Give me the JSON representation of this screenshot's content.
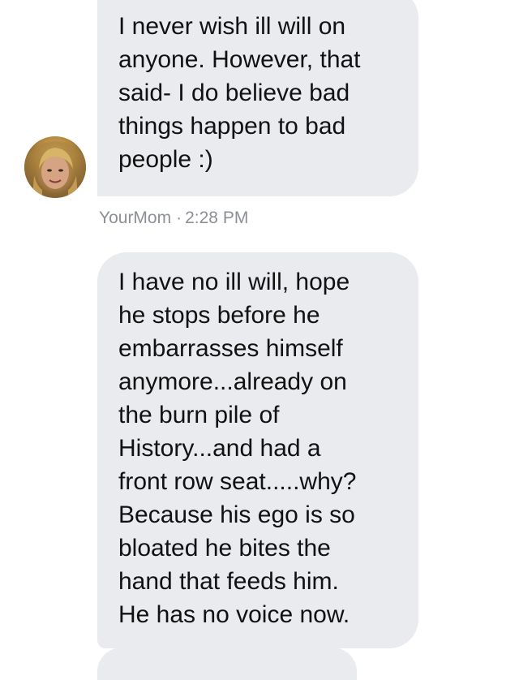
{
  "messages": [
    {
      "lines": [
        "I never wish ill will on",
        "anyone. However, that",
        "said- I do believe bad",
        "things happen to bad",
        "people :)"
      ]
    },
    {
      "lines": [
        "I have no ill will, hope",
        "he stops before he",
        "embarrasses himself",
        "anymore...already on",
        "the burn pile of",
        "History...and had a",
        "front row seat.....why?",
        "Because his ego is so",
        "bloated he bites the",
        "hand that feeds him.",
        "He has no voice now."
      ]
    }
  ],
  "meta": {
    "sender": "YourMom",
    "separator": "·",
    "time": "2:28 PM"
  },
  "colors": {
    "bubble_background": "#e9ebef",
    "meta_text": "#8b8f96",
    "message_text": "#111111"
  },
  "icons": {
    "avatar": "profile-photo-avatar"
  }
}
